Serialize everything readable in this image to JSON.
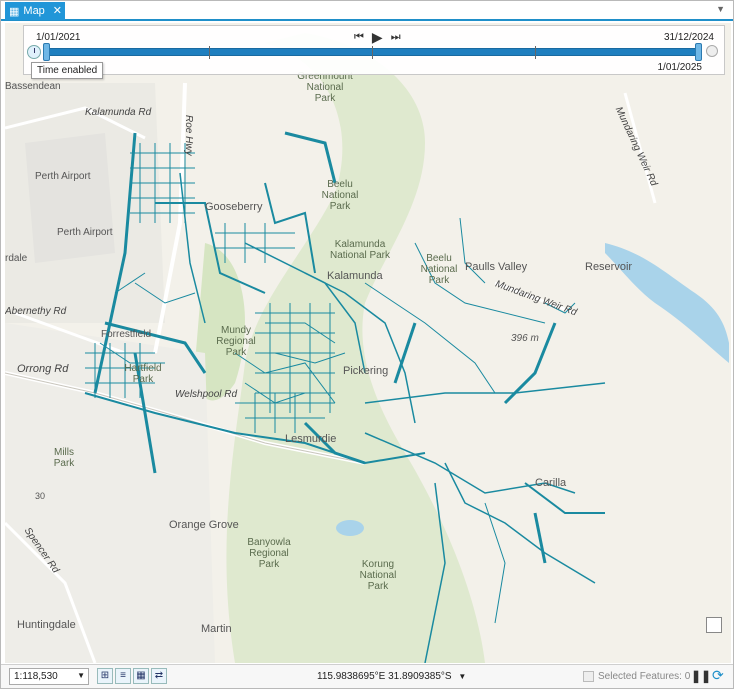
{
  "tab": {
    "title": "Map"
  },
  "time_slider": {
    "start": "1/01/2021",
    "end_top": "31/12/2024",
    "end_bottom": "1/01/2025",
    "tooltip": "Time enabled"
  },
  "map_labels": {
    "perth_airport": "Perth Airport",
    "perth_airport2": "Perth Airport",
    "kalamunda_rd": "Kalamunda Rd",
    "roe_hwy": "Roe Hwy",
    "abernethy_rd": "Abernethy Rd",
    "orrong_rd": "Orrong Rd",
    "spencer_rd": "Spencer Rd",
    "mundaring_weir_rd": "Mundaring Weir Rd",
    "mundaring_weir_rd2": "Mundaring Weir Rd",
    "welshpool_rd": "Welshpool Rd",
    "greenmount_np": "Greenmount National Park",
    "beelu_np": "Beelu National Park",
    "beelu_np2": "Beelu National Park",
    "kalamunda_np": "Kalamunda National Park",
    "kalamunda": "Kalamunda",
    "paulls_valley": "Paulls Valley",
    "reservoir": "Reservoir",
    "mundy_rp": "Mundy Regional Park",
    "hartfield_park": "Hartfield Park",
    "gooseberry": "Gooseberry",
    "lesmurdie": "Lesmurdie",
    "pickering": "Pickering",
    "forrestfield": "Forrestfield",
    "mills_park": "Mills Park",
    "orange_grove": "Orange Grove",
    "banyowla_rp": "Banyowla Regional Park",
    "korung_np": "Korung National Park",
    "martin": "Martin",
    "carilla": "Carilla",
    "huntingdale": "Huntingdale",
    "bassendean": "Bassendean",
    "elev": "396 m",
    "rdale": "rdale",
    "route_30": "30"
  },
  "status": {
    "scale": "1:118,530",
    "coords": "115.9838695°E 31.8909385°S",
    "selected": "Selected Features: 0"
  },
  "colors": {
    "accent": "#1f8fc9",
    "network": "#1a8aa0",
    "water": "#a9d3ea"
  }
}
